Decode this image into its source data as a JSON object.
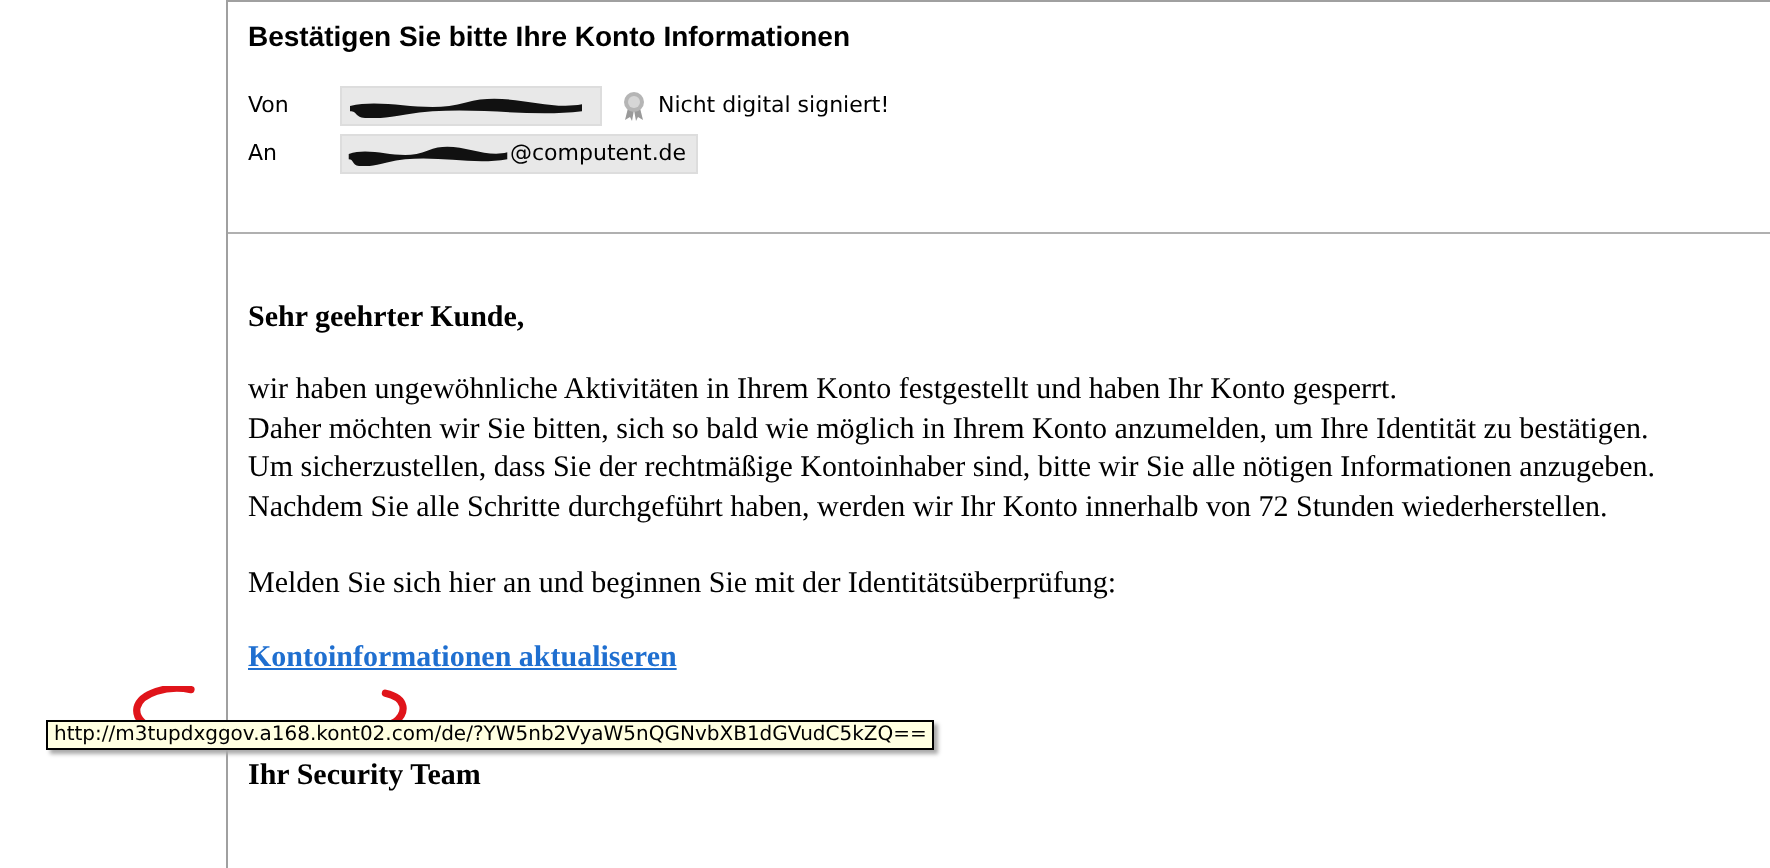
{
  "message": {
    "subject": "Bestätigen Sie bitte Ihre Konto Informationen",
    "from": {
      "label": "Von"
    },
    "signature": {
      "status": "Nicht digital signiert!"
    },
    "to": {
      "label": "An",
      "address": "@computent.de"
    }
  },
  "body": {
    "greeting": "Sehr geehrter Kunde,",
    "lines": [
      "wir haben ungewöhnliche Aktivitäten in Ihrem Konto festgestellt und haben Ihr Konto gesperrt.",
      "Daher möchten wir Sie bitten, sich so bald wie möglich in Ihrem Konto anzumelden, um Ihre Identität zu bestätigen.",
      "Um sicherzustellen, dass Sie der rechtmäßige Kontoinhaber sind, bitte wir Sie alle nötigen Informationen anzugeben.",
      "Nachdem Sie alle Schritte durchgeführt haben, werden wir Ihr Konto innerhalb von 72 Stunden wiederherstellen."
    ],
    "prompt": "Melden Sie sich hier an und beginnen Sie mit der Identitätsüberprüfung:",
    "link": "Kontoinformationen aktualiseren",
    "closing": "Ihr Security Team"
  },
  "tooltip": {
    "text": "http://m3tupdxggov.a168.kont02.com/de/?YW5nb2VyaW5nQGNvbXB1dGVudC5kZQ=="
  }
}
